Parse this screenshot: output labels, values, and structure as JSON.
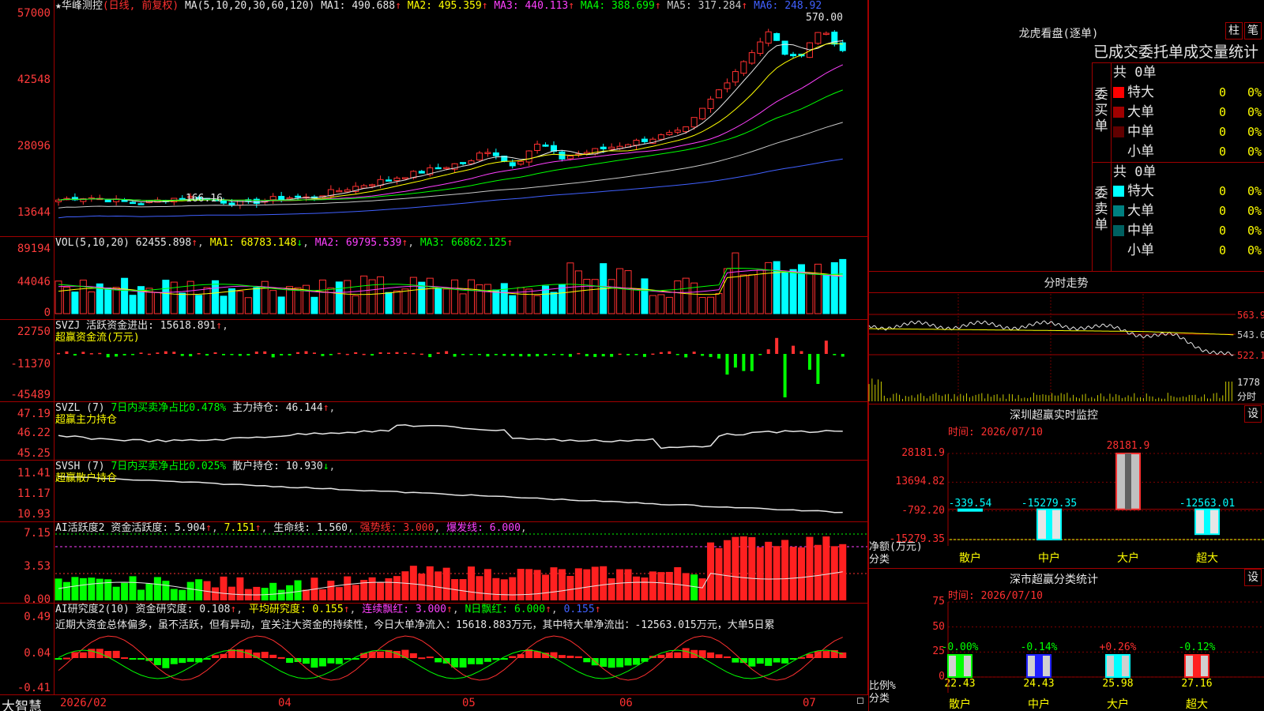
{
  "main": {
    "stock_name": "华峰测控",
    "mode": "(日线, 前复权)",
    "ma_header": "MA(5,10,20,30,60,120)",
    "ma_values": [
      {
        "label": "MA1:",
        "value": "490.688",
        "color": "#e6e6e6"
      },
      {
        "label": "MA2:",
        "value": "495.359",
        "color": "#ffff00"
      },
      {
        "label": "MA3:",
        "value": "440.113",
        "color": "#ff40ff"
      },
      {
        "label": "MA4:",
        "value": "388.699",
        "color": "#00ff00"
      },
      {
        "label": "MA5:",
        "value": "317.284",
        "color": "#c8c8c8"
      },
      {
        "label": "MA6:",
        "value": "248.92",
        "color": "#4060ff"
      }
    ],
    "y_ticks": [
      "57000",
      "42548",
      "28096",
      "13644"
    ],
    "high_mark": "570.00",
    "low_mark": "166.16"
  },
  "vol": {
    "header": "VOL(5,10,20)",
    "value": "62455.898",
    "ma1": "68783.148",
    "ma2": "69795.539",
    "ma3": "66862.125",
    "y_ticks": [
      "89194",
      "44046",
      "0"
    ]
  },
  "svzj": {
    "header": "SVZJ",
    "line1": "活跃资金进出: 15618.891",
    "line2": "超赢资金流(万元)",
    "y_ticks": [
      "22750",
      "-11370",
      "-45489"
    ]
  },
  "svzl": {
    "header": "SVZL (7)",
    "pct": "7日内买卖净占比0.478%",
    "hold": "主力持仓: 46.144",
    "line2": "超赢主力持仓",
    "y_ticks": [
      "47.19",
      "46.22",
      "45.25"
    ]
  },
  "svsh": {
    "header": "SVSH (7)",
    "pct": "7日内买卖净占比0.025%",
    "hold": "散户持仓: 10.930",
    "line2": "超赢散户持仓",
    "y_ticks": [
      "11.41",
      "11.17",
      "10.93"
    ]
  },
  "ai_act": {
    "header": "AI活跃度2",
    "v1": "资金活跃度: 5.904",
    "v2": "7.151",
    "v3": "生命线: 1.560",
    "v4": "强势线: 3.000",
    "v5": "爆发线: 6.000",
    "y_ticks": [
      "7.15",
      "3.53",
      "0.00"
    ]
  },
  "ai_res": {
    "header": "AI研究度2(10)",
    "v1": "资金研究度: 0.108",
    "v2": "平均研究度: 0.155",
    "v3": "连续飘红: 3.000",
    "v4": "N日飘红: 6.000",
    "v5": "0.155",
    "comment": "近期大资金总体偏多，虽不活跃，但有异动，宜关注大资金的持续性，今日大单净流入：15618.883万元，其中特大单净流出：-12563.015万元，大单5日累",
    "y_ticks": [
      "0.49",
      "0.04",
      "-0.41"
    ]
  },
  "xaxis": {
    "brand": "大智慧",
    "labels": [
      "2026/02",
      "04",
      "05",
      "06",
      "07"
    ]
  },
  "right": {
    "lhb_title": "龙虎看盘(逐单)",
    "btn_zhu": "柱",
    "btn_bi": "笔",
    "tabs_text": "已成交委托单成交量统计",
    "buy": {
      "side_label": "委买单",
      "total": "共 0单",
      "rows": [
        {
          "name": "特大",
          "count": "0",
          "pct": "0%",
          "color": "#ff0000"
        },
        {
          "name": "大单",
          "count": "0",
          "pct": "0%",
          "color": "#a00000"
        },
        {
          "name": "中单",
          "count": "0",
          "pct": "0%",
          "color": "#600000"
        },
        {
          "name": "小单",
          "count": "0",
          "pct": "0%",
          "color": "#000000"
        }
      ]
    },
    "sell": {
      "side_label": "委卖单",
      "total": "共 0单",
      "rows": [
        {
          "name": "特大",
          "count": "0",
          "pct": "0%",
          "color": "#00ffff"
        },
        {
          "name": "大单",
          "count": "0",
          "pct": "0%",
          "color": "#008080"
        },
        {
          "name": "中单",
          "count": "0",
          "pct": "0%",
          "color": "#006060"
        },
        {
          "name": "小单",
          "count": "0",
          "pct": "0%",
          "color": "#000000"
        }
      ]
    },
    "intraday": {
      "title": "分时走势",
      "y_ticks": [
        "563.9",
        "543.0",
        "522.1"
      ],
      "vol_label": "1778",
      "vol_unit": "分时"
    },
    "sz_monitor": {
      "title": "深圳超赢实时监控",
      "btn": "设",
      "time": "时间: 2026/07/10",
      "y_ticks": [
        "28181.9",
        "13694.82",
        "-792.20",
        "-15279.35"
      ],
      "unit_label": "净额(万元)",
      "cat_label": "分类",
      "chart_data": {
        "type": "bar",
        "categories": [
          "散户",
          "中户",
          "大户",
          "超大"
        ],
        "values": [
          -339.54,
          -15279.35,
          28181.9,
          -12563.01
        ],
        "value_labels": [
          "-339.54",
          "-15279.35",
          "28181.9",
          "-12563.01"
        ],
        "ylim": [
          -15279.35,
          28181.9
        ]
      }
    },
    "sz_class": {
      "title": "深市超赢分类统计",
      "btn": "设",
      "time": "时间: 2026/07/10",
      "y_ticks": [
        "75",
        "50",
        "25",
        "0"
      ],
      "unit_label": "比例%",
      "cat_label": "分类",
      "chart_data": {
        "type": "bar",
        "categories": [
          "散户",
          "中户",
          "大户",
          "超大"
        ],
        "values": [
          22.43,
          24.43,
          25.98,
          27.16
        ],
        "value_labels": [
          "22.43",
          "24.43",
          "25.98",
          "27.16"
        ],
        "changes": [
          "-0.00%",
          "-0.14%",
          "+0.26%",
          "-0.12%"
        ],
        "colors": [
          "#00ff00",
          "#2020ff",
          "#00ffff",
          "#ff2020"
        ],
        "ylim": [
          0,
          75
        ]
      }
    }
  }
}
